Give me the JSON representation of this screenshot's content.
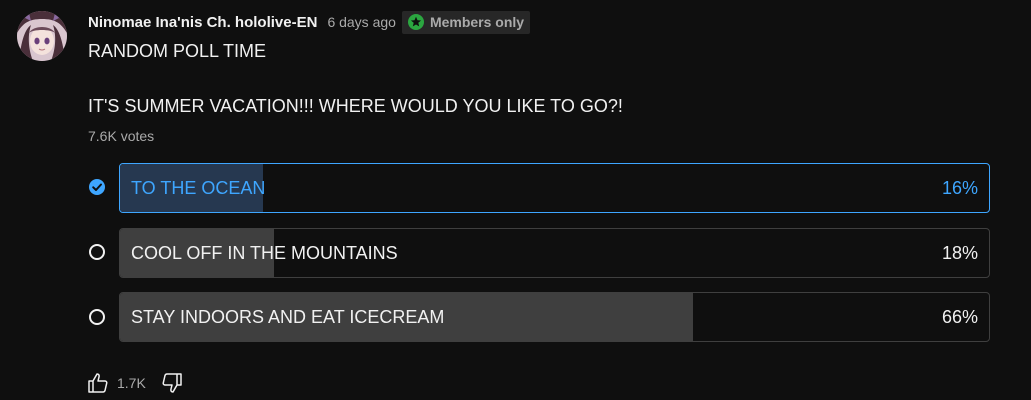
{
  "post": {
    "author": "Ninomae Ina'nis Ch. hololive-EN",
    "time": "6 days ago",
    "badge": "Members only",
    "line1": "RANDOM POLL TIME",
    "line2": "IT'S SUMMER VACATION!!! WHERE WOULD YOU LIKE TO GO?!",
    "votes": "7.6K votes"
  },
  "poll": {
    "options": [
      {
        "label": "TO THE OCEAN",
        "percent_text": "16%",
        "fraction": 0.164,
        "selected": true
      },
      {
        "label": "COOL OFF IN THE MOUNTAINS",
        "percent_text": "18%",
        "fraction": 0.177,
        "selected": false
      },
      {
        "label": "STAY INDOORS AND EAT ICECREAM",
        "percent_text": "66%",
        "fraction": 0.659,
        "selected": false
      }
    ]
  },
  "actions": {
    "like_count": "1.7K",
    "like_icon": "thumbs-up-icon",
    "dislike_icon": "thumbs-down-icon"
  },
  "colors": {
    "background": "#0f0f0f",
    "accent": "#3ea6ff",
    "selected_fill": "#263850",
    "bar_fill": "#3f3f3f",
    "badge_star": "#2ba640"
  }
}
